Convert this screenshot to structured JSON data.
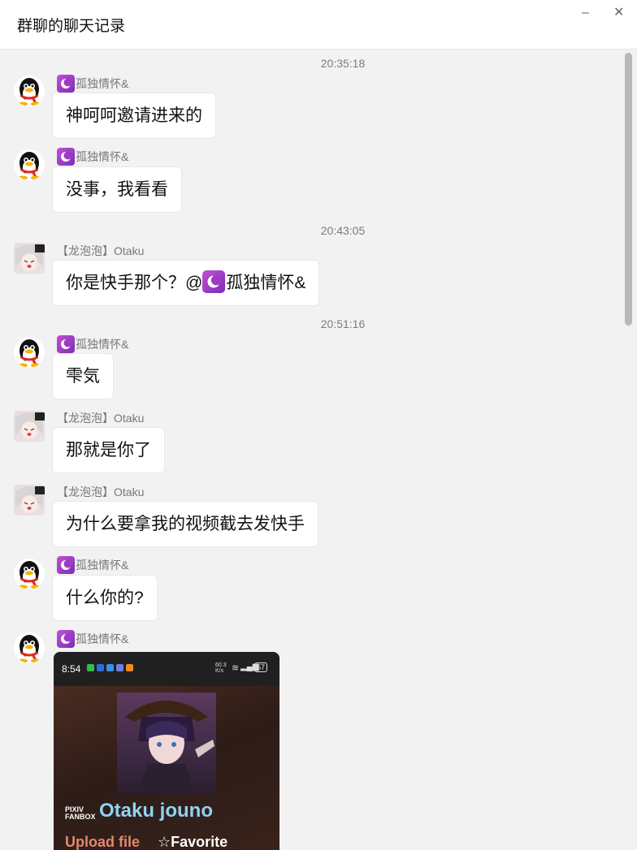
{
  "window": {
    "title": "群聊的聊天记录",
    "minimize_glyph": "–",
    "close_glyph": "✕"
  },
  "messages": [
    {
      "timestamp": "20:35:18",
      "sender": "孤独情怀&",
      "sender_badge": "moon-icon",
      "avatar": "qq-penguin-avatar",
      "text": "神呵呵邀请进来的"
    },
    {
      "sender": "孤独情怀&",
      "sender_badge": "moon-icon",
      "avatar": "qq-penguin-avatar",
      "text": "没事，我看看"
    },
    {
      "timestamp": "20:43:05",
      "sender": "【龙泡泡】Otaku",
      "avatar": "anime-girl-avatar",
      "text_prefix": "你是快手那个？@",
      "mention": "孤独情怀&"
    },
    {
      "timestamp": "20:51:16",
      "sender": "孤独情怀&",
      "sender_badge": "moon-icon",
      "avatar": "qq-penguin-avatar",
      "text": "雫気"
    },
    {
      "sender": "【龙泡泡】Otaku",
      "avatar": "anime-girl-avatar",
      "text": "那就是你了"
    },
    {
      "sender": "【龙泡泡】Otaku",
      "avatar": "anime-girl-avatar",
      "text": "为什么要拿我的视频截去发快手"
    },
    {
      "sender": "孤独情怀&",
      "sender_badge": "moon-icon",
      "avatar": "qq-penguin-avatar",
      "text": "什么你的?"
    },
    {
      "sender": "孤独情怀&",
      "sender_badge": "moon-icon",
      "avatar": "qq-penguin-avatar",
      "image": {
        "status_time": "8:54",
        "net_speed": "60.3\nK/s",
        "battery": "57",
        "brand": "PIXIV\nFANBOX",
        "title": "Otaku jouno",
        "upload": "Upload file",
        "favorite": "☆Favorite"
      }
    }
  ],
  "colors": {
    "background": "#f2f2f2",
    "bubble": "#ffffff",
    "timestamp": "#7c7c7c",
    "badge_purple": "#9b3cc4",
    "otaku_title": "#8fd3f2",
    "upload": "#e0896c"
  }
}
